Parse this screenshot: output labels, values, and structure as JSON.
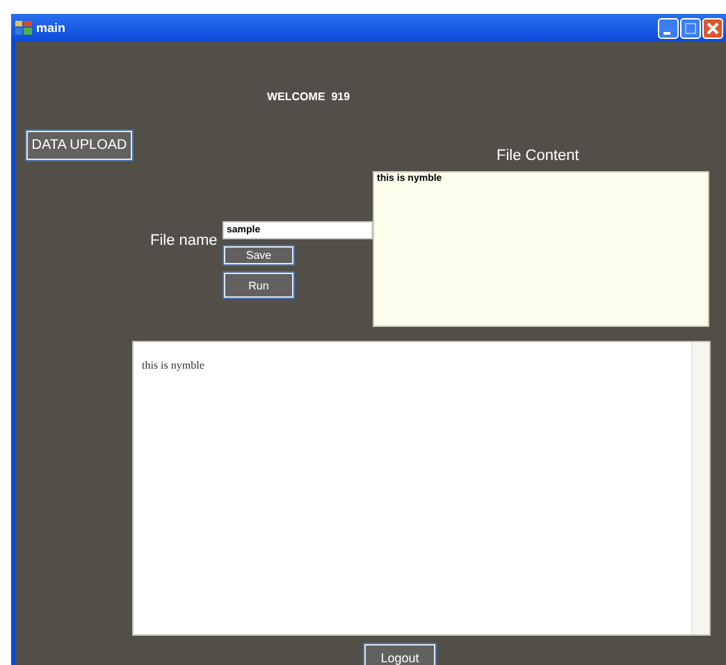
{
  "window": {
    "title": "main"
  },
  "welcome": "WELCOME  919",
  "upload_button": "DATA UPLOAD",
  "file_content_label": "File Content",
  "file_content": "this is nymble",
  "file_name": {
    "label": "File name",
    "value": "sample"
  },
  "save_button": "Save",
  "run_button": "Run",
  "output": "this is nymble",
  "logout_button": "Logout"
}
